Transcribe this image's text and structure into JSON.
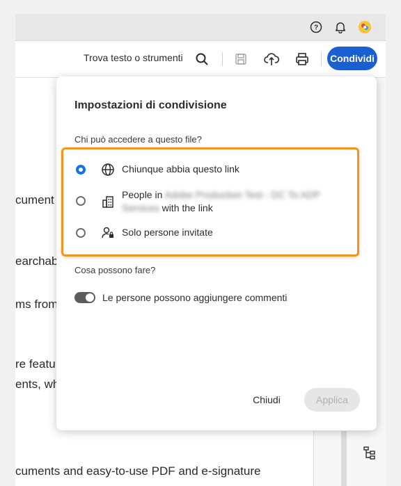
{
  "topbar": {
    "help_icon": "help-circle-icon",
    "bell_icon": "bell-icon",
    "avatar_icon": "avatar-icon"
  },
  "toolbar": {
    "find_label": "Trova testo o strumenti",
    "share_label": "Condividi",
    "accent_color": "#1a5fd1"
  },
  "document": {
    "lines": [
      "cument",
      "earchab",
      "ms from",
      "re featu",
      "ents, wh",
      "cuments and easy-to-use PDF and e-signature"
    ]
  },
  "dialog": {
    "title": "Impostazioni di condivisione",
    "access_question": "Chi può accedere a questo file?",
    "options": [
      {
        "label": "Chiunque abbia questo link",
        "selected": true
      },
      {
        "label_prefix": "People in",
        "label_redacted": "Adobe Production Test - DC To ADP Services",
        "label_suffix": "with the link",
        "selected": false
      },
      {
        "label": "Solo persone invitate",
        "selected": false
      }
    ],
    "permissions_question": "Cosa possono fare?",
    "toggle_label": "Le persone possono aggiungere commenti",
    "toggle_on": true,
    "close_label": "Chiudi",
    "apply_label": "Applica",
    "highlight_color": "#f29423"
  }
}
